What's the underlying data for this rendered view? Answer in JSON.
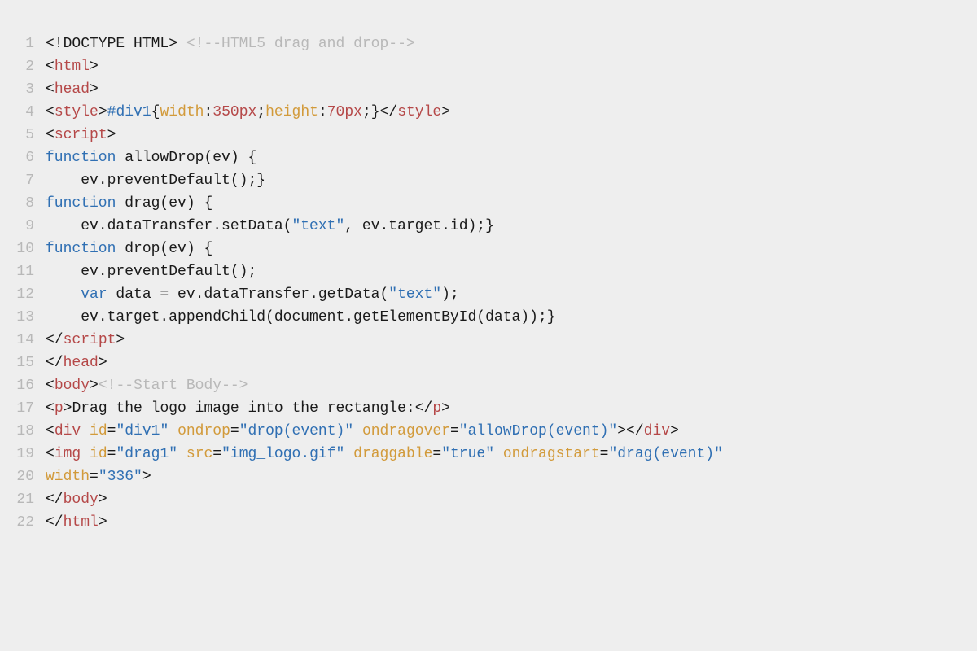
{
  "lines": [
    {
      "n": "1",
      "tokens": [
        {
          "t": "<!DOCTYPE HTML>",
          "c": "c-doctype"
        },
        {
          "t": " ",
          "c": "c-default"
        },
        {
          "t": "<!--HTML5 drag and drop-->",
          "c": "c-comment"
        }
      ]
    },
    {
      "n": "2",
      "tokens": [
        {
          "t": "<",
          "c": "c-angle"
        },
        {
          "t": "html",
          "c": "c-tag"
        },
        {
          "t": ">",
          "c": "c-angle"
        }
      ]
    },
    {
      "n": "3",
      "tokens": [
        {
          "t": "<",
          "c": "c-angle"
        },
        {
          "t": "head",
          "c": "c-tag"
        },
        {
          "t": ">",
          "c": "c-angle"
        }
      ]
    },
    {
      "n": "4",
      "tokens": [
        {
          "t": "<",
          "c": "c-angle"
        },
        {
          "t": "style",
          "c": "c-tag"
        },
        {
          "t": ">",
          "c": "c-angle"
        },
        {
          "t": "#div1",
          "c": "c-selector"
        },
        {
          "t": "{",
          "c": "c-punct"
        },
        {
          "t": "width",
          "c": "c-attr"
        },
        {
          "t": ":",
          "c": "c-punct"
        },
        {
          "t": "350px",
          "c": "c-pxunit"
        },
        {
          "t": ";",
          "c": "c-punct"
        },
        {
          "t": "height",
          "c": "c-attr"
        },
        {
          "t": ":",
          "c": "c-punct"
        },
        {
          "t": "70px",
          "c": "c-pxunit"
        },
        {
          "t": ";}",
          "c": "c-punct"
        },
        {
          "t": "</",
          "c": "c-angle"
        },
        {
          "t": "style",
          "c": "c-tag"
        },
        {
          "t": ">",
          "c": "c-angle"
        }
      ]
    },
    {
      "n": "5",
      "tokens": [
        {
          "t": "<",
          "c": "c-angle"
        },
        {
          "t": "script",
          "c": "c-tag"
        },
        {
          "t": ">",
          "c": "c-angle"
        }
      ]
    },
    {
      "n": "6",
      "tokens": [
        {
          "t": "function",
          "c": "c-keyword"
        },
        {
          "t": " allowDrop(ev) {",
          "c": "c-default"
        }
      ]
    },
    {
      "n": "7",
      "tokens": [
        {
          "t": "    ev.preventDefault();}",
          "c": "c-default"
        }
      ]
    },
    {
      "n": "8",
      "tokens": [
        {
          "t": "function",
          "c": "c-keyword"
        },
        {
          "t": " drag(ev) {",
          "c": "c-default"
        }
      ]
    },
    {
      "n": "9",
      "tokens": [
        {
          "t": "    ev.dataTransfer.setData(",
          "c": "c-default"
        },
        {
          "t": "\"text\"",
          "c": "c-string"
        },
        {
          "t": ", ev.target.id);}",
          "c": "c-default"
        }
      ]
    },
    {
      "n": "10",
      "tokens": [
        {
          "t": "function",
          "c": "c-keyword"
        },
        {
          "t": " drop(ev) {",
          "c": "c-default"
        }
      ]
    },
    {
      "n": "11",
      "tokens": [
        {
          "t": "    ev.preventDefault();",
          "c": "c-default"
        }
      ]
    },
    {
      "n": "12",
      "tokens": [
        {
          "t": "    ",
          "c": "c-default"
        },
        {
          "t": "var",
          "c": "c-keyword"
        },
        {
          "t": " data = ev.dataTransfer.getData(",
          "c": "c-default"
        },
        {
          "t": "\"text\"",
          "c": "c-string"
        },
        {
          "t": ");",
          "c": "c-default"
        }
      ]
    },
    {
      "n": "13",
      "tokens": [
        {
          "t": "    ev.target.appendChild(document.getElementById(data));}",
          "c": "c-default"
        }
      ]
    },
    {
      "n": "14",
      "tokens": [
        {
          "t": "</",
          "c": "c-angle"
        },
        {
          "t": "script",
          "c": "c-tag"
        },
        {
          "t": ">",
          "c": "c-angle"
        }
      ]
    },
    {
      "n": "15",
      "tokens": [
        {
          "t": "</",
          "c": "c-angle"
        },
        {
          "t": "head",
          "c": "c-tag"
        },
        {
          "t": ">",
          "c": "c-angle"
        }
      ]
    },
    {
      "n": "16",
      "tokens": [
        {
          "t": "<",
          "c": "c-angle"
        },
        {
          "t": "body",
          "c": "c-tag"
        },
        {
          "t": ">",
          "c": "c-angle"
        },
        {
          "t": "<!--Start Body-->",
          "c": "c-comment"
        }
      ]
    },
    {
      "n": "17",
      "tokens": [
        {
          "t": "<",
          "c": "c-angle"
        },
        {
          "t": "p",
          "c": "c-tag"
        },
        {
          "t": ">",
          "c": "c-angle"
        },
        {
          "t": "Drag the logo image into the rectangle:",
          "c": "c-default"
        },
        {
          "t": "</",
          "c": "c-angle"
        },
        {
          "t": "p",
          "c": "c-tag"
        },
        {
          "t": ">",
          "c": "c-angle"
        }
      ]
    },
    {
      "n": "18",
      "tokens": [
        {
          "t": "<",
          "c": "c-angle"
        },
        {
          "t": "div",
          "c": "c-tag"
        },
        {
          "t": " ",
          "c": "c-default"
        },
        {
          "t": "id",
          "c": "c-attr"
        },
        {
          "t": "=",
          "c": "c-punct"
        },
        {
          "t": "\"div1\"",
          "c": "c-string"
        },
        {
          "t": " ",
          "c": "c-default"
        },
        {
          "t": "ondrop",
          "c": "c-attr"
        },
        {
          "t": "=",
          "c": "c-punct"
        },
        {
          "t": "\"drop(event)\"",
          "c": "c-string"
        },
        {
          "t": " ",
          "c": "c-default"
        },
        {
          "t": "ondragover",
          "c": "c-attr"
        },
        {
          "t": "=",
          "c": "c-punct"
        },
        {
          "t": "\"allowDrop(event)\"",
          "c": "c-string"
        },
        {
          "t": ">",
          "c": "c-angle"
        },
        {
          "t": "</",
          "c": "c-angle"
        },
        {
          "t": "div",
          "c": "c-tag"
        },
        {
          "t": ">",
          "c": "c-angle"
        }
      ]
    },
    {
      "n": "19",
      "tokens": [
        {
          "t": "<",
          "c": "c-angle"
        },
        {
          "t": "img",
          "c": "c-tag"
        },
        {
          "t": " ",
          "c": "c-default"
        },
        {
          "t": "id",
          "c": "c-attr"
        },
        {
          "t": "=",
          "c": "c-punct"
        },
        {
          "t": "\"drag1\"",
          "c": "c-string"
        },
        {
          "t": " ",
          "c": "c-default"
        },
        {
          "t": "src",
          "c": "c-attr"
        },
        {
          "t": "=",
          "c": "c-punct"
        },
        {
          "t": "\"img_logo.gif\"",
          "c": "c-string"
        },
        {
          "t": " ",
          "c": "c-default"
        },
        {
          "t": "draggable",
          "c": "c-attr"
        },
        {
          "t": "=",
          "c": "c-punct"
        },
        {
          "t": "\"true\"",
          "c": "c-string"
        },
        {
          "t": " ",
          "c": "c-default"
        },
        {
          "t": "ondragstart",
          "c": "c-attr"
        },
        {
          "t": "=",
          "c": "c-punct"
        },
        {
          "t": "\"drag(event)\"",
          "c": "c-string"
        }
      ]
    },
    {
      "n": "20",
      "tokens": [
        {
          "t": "width",
          "c": "c-attr"
        },
        {
          "t": "=",
          "c": "c-punct"
        },
        {
          "t": "\"336\"",
          "c": "c-string"
        },
        {
          "t": ">",
          "c": "c-angle"
        }
      ]
    },
    {
      "n": "21",
      "tokens": [
        {
          "t": "</",
          "c": "c-angle"
        },
        {
          "t": "body",
          "c": "c-tag"
        },
        {
          "t": ">",
          "c": "c-angle"
        }
      ]
    },
    {
      "n": "22",
      "tokens": [
        {
          "t": "</",
          "c": "c-angle"
        },
        {
          "t": "html",
          "c": "c-tag"
        },
        {
          "t": ">",
          "c": "c-angle"
        }
      ]
    }
  ]
}
